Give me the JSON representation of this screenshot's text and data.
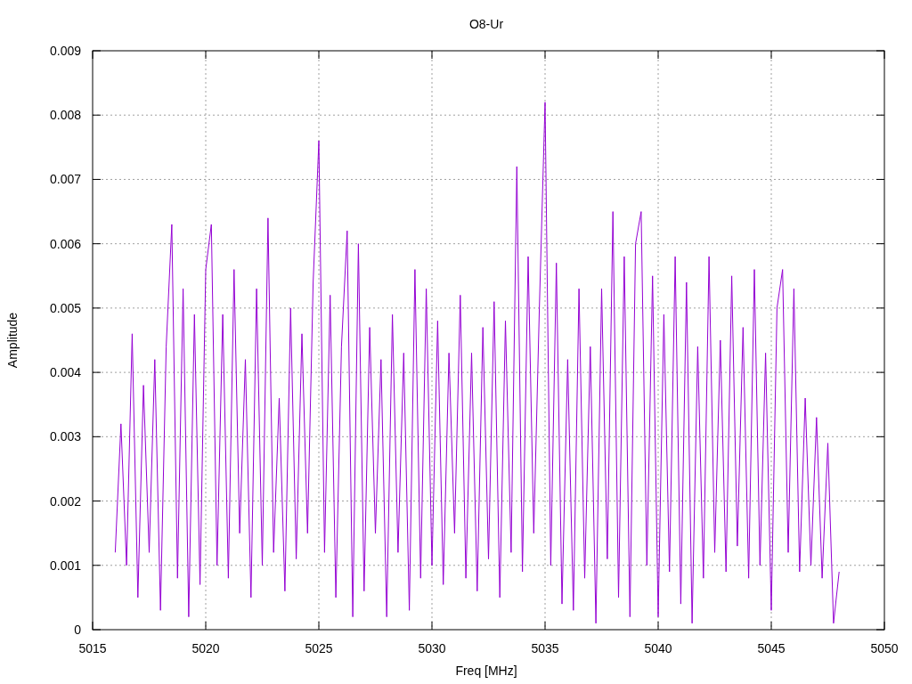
{
  "chart_data": {
    "type": "line",
    "grid": true,
    "title": "O8-Ur",
    "xlabel": "Freq [MHz]",
    "ylabel": "Amplitude",
    "xlim": [
      5015,
      5050
    ],
    "ylim": [
      0,
      0.009
    ],
    "xticks": [
      5015,
      5020,
      5025,
      5030,
      5035,
      5040,
      5045,
      5050
    ],
    "yticks": [
      0,
      0.001,
      0.002,
      0.003,
      0.004,
      0.005,
      0.006,
      0.007,
      0.008,
      0.009
    ],
    "x": [
      5016,
      5016.25,
      5016.5,
      5016.75,
      5017,
      5017.25,
      5017.5,
      5017.75,
      5018,
      5018.25,
      5018.5,
      5018.75,
      5019,
      5019.25,
      5019.5,
      5019.75,
      5020,
      5020.25,
      5020.5,
      5020.75,
      5021,
      5021.25,
      5021.5,
      5021.75,
      5022,
      5022.25,
      5022.5,
      5022.75,
      5023,
      5023.25,
      5023.5,
      5023.75,
      5024,
      5024.25,
      5024.5,
      5024.75,
      5025,
      5025.25,
      5025.5,
      5025.75,
      5026,
      5026.25,
      5026.5,
      5026.75,
      5027,
      5027.25,
      5027.5,
      5027.75,
      5028,
      5028.25,
      5028.5,
      5028.75,
      5029,
      5029.25,
      5029.5,
      5029.75,
      5030,
      5030.25,
      5030.5,
      5030.75,
      5031,
      5031.25,
      5031.5,
      5031.75,
      5032,
      5032.25,
      5032.5,
      5032.75,
      5033,
      5033.25,
      5033.5,
      5033.75,
      5034,
      5034.25,
      5034.5,
      5034.75,
      5035,
      5035.25,
      5035.5,
      5035.75,
      5036,
      5036.25,
      5036.5,
      5036.75,
      5037,
      5037.25,
      5037.5,
      5037.75,
      5038,
      5038.25,
      5038.5,
      5038.75,
      5039,
      5039.25,
      5039.5,
      5039.75,
      5040,
      5040.25,
      5040.5,
      5040.75,
      5041,
      5041.25,
      5041.5,
      5041.75,
      5042,
      5042.25,
      5042.5,
      5042.75,
      5043,
      5043.25,
      5043.5,
      5043.75,
      5044,
      5044.25,
      5044.5,
      5044.75,
      5045,
      5045.25,
      5045.5,
      5045.75,
      5046,
      5046.25,
      5046.5,
      5046.75,
      5047,
      5047.25,
      5047.5,
      5047.75,
      5048
    ],
    "series": [
      {
        "color": "#9400d3",
        "values": [
          0.0012,
          0.0032,
          0.001,
          0.0046,
          0.0005,
          0.0038,
          0.0012,
          0.0042,
          0.0003,
          0.0044,
          0.0063,
          0.0008,
          0.0053,
          0.0002,
          0.0049,
          0.0007,
          0.0056,
          0.0063,
          0.001,
          0.0049,
          0.0008,
          0.0056,
          0.0015,
          0.0042,
          0.0005,
          0.0053,
          0.001,
          0.0064,
          0.0012,
          0.0036,
          0.0006,
          0.005,
          0.0011,
          0.0046,
          0.0015,
          0.0054,
          0.0076,
          0.0012,
          0.0052,
          0.0005,
          0.0044,
          0.0062,
          0.0002,
          0.006,
          0.0006,
          0.0047,
          0.0015,
          0.0042,
          0.0002,
          0.0049,
          0.0012,
          0.0043,
          0.0003,
          0.0056,
          0.0008,
          0.0053,
          0.001,
          0.0048,
          0.0007,
          0.0043,
          0.0015,
          0.0052,
          0.0008,
          0.0043,
          0.0006,
          0.0047,
          0.0011,
          0.0051,
          0.0005,
          0.0048,
          0.0012,
          0.0072,
          0.0009,
          0.0058,
          0.0015,
          0.005,
          0.0082,
          0.001,
          0.0057,
          0.0004,
          0.0042,
          0.0003,
          0.0053,
          0.0008,
          0.0044,
          0.0001,
          0.0053,
          0.0011,
          0.0065,
          0.0005,
          0.0058,
          0.0002,
          0.006,
          0.0065,
          0.001,
          0.0055,
          0.0002,
          0.0049,
          0.0009,
          0.0058,
          0.0004,
          0.0054,
          0.0001,
          0.0044,
          0.0008,
          0.0058,
          0.0012,
          0.0045,
          0.0009,
          0.0055,
          0.0013,
          0.0047,
          0.0008,
          0.0056,
          0.001,
          0.0043,
          0.0003,
          0.005,
          0.0056,
          0.0012,
          0.0053,
          0.0009,
          0.0036,
          0.001,
          0.0033,
          0.0008,
          0.0029,
          0.0001,
          0.0009
        ]
      }
    ]
  }
}
